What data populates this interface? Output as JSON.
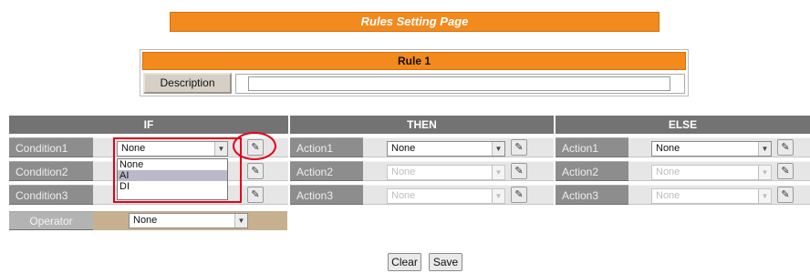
{
  "page": {
    "title": "Rules Setting Page"
  },
  "rule": {
    "title": "Rule 1",
    "description_label": "Description",
    "description_value": ""
  },
  "if_section": {
    "header": "IF",
    "rows": [
      {
        "label": "Condition1",
        "value": "None"
      },
      {
        "label": "Condition2",
        "value": ""
      },
      {
        "label": "Condition3",
        "value": ""
      }
    ],
    "dropdown_options": [
      "None",
      "AI",
      "DI"
    ],
    "highlighted_option": "AI",
    "operator_label": "Operator",
    "operator_value": "None"
  },
  "then_section": {
    "header": "THEN",
    "rows": [
      {
        "label": "Action1",
        "value": "None",
        "enabled": true
      },
      {
        "label": "Action2",
        "value": "None",
        "enabled": false
      },
      {
        "label": "Action3",
        "value": "None",
        "enabled": false
      }
    ]
  },
  "else_section": {
    "header": "ELSE",
    "rows": [
      {
        "label": "Action1",
        "value": "None",
        "enabled": true
      },
      {
        "label": "Action2",
        "value": "None",
        "enabled": false
      },
      {
        "label": "Action3",
        "value": "None",
        "enabled": false
      }
    ]
  },
  "buttons": {
    "clear": "Clear",
    "save": "Save"
  },
  "icons": {
    "select_arrow": "chevron-down-icon",
    "edit": "pencil-icon"
  },
  "colors": {
    "accent_orange": "#f28a1e",
    "header_gray": "#737373",
    "label_gray": "#8d8d8d",
    "annotation_red": "#e3001b"
  }
}
